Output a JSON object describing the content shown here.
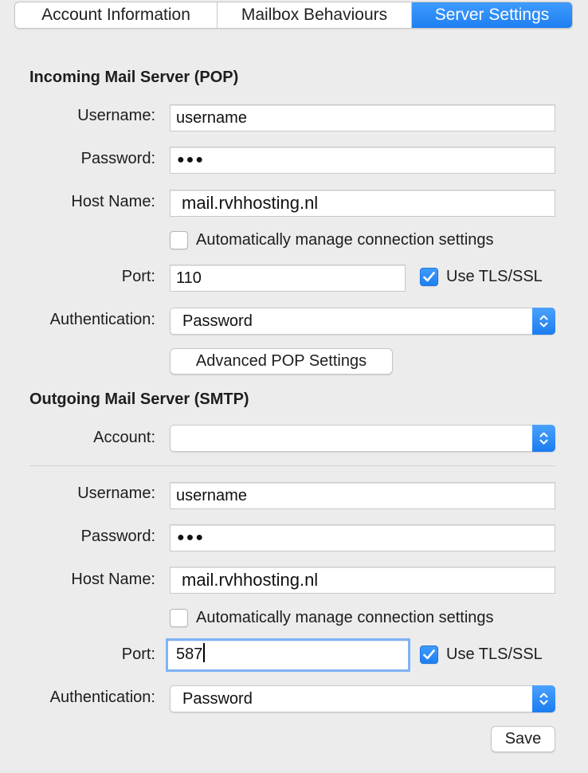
{
  "tabs": [
    "Account Information",
    "Mailbox Behaviours",
    "Server Settings"
  ],
  "active_tab": "Server Settings",
  "incoming": {
    "title": "Incoming Mail Server (POP)",
    "username_label": "Username:",
    "username": "username",
    "password_label": "Password:",
    "password": "●●●",
    "host_label": "Host Name:",
    "host": "mail.rvhhosting.nl",
    "auto_manage_label": "Automatically manage connection settings",
    "auto_manage_checked": false,
    "port_label": "Port:",
    "port": "110",
    "tls_label": "Use TLS/SSL",
    "tls_checked": true,
    "auth_label": "Authentication:",
    "auth_value": "Password",
    "advanced_button": "Advanced POP Settings"
  },
  "outgoing": {
    "title": "Outgoing Mail Server (SMTP)",
    "account_label": "Account:",
    "account_value": "",
    "username_label": "Username:",
    "username": "username",
    "password_label": "Password:",
    "password": "●●●",
    "host_label": "Host Name:",
    "host": "mail.rvhhosting.nl",
    "auto_manage_label": "Automatically manage connection settings",
    "auto_manage_checked": false,
    "port_label": "Port:",
    "port": "587",
    "tls_label": "Use TLS/SSL",
    "tls_checked": true,
    "auth_label": "Authentication:",
    "auth_value": "Password"
  },
  "save_button": "Save",
  "icons": {
    "checkmark": "checkmark-icon",
    "stepper": "up-down-chevron-icon"
  },
  "colors": {
    "accent": "#1e7ff0",
    "background": "#ececec",
    "focus_ring": "#7fb3f5"
  }
}
